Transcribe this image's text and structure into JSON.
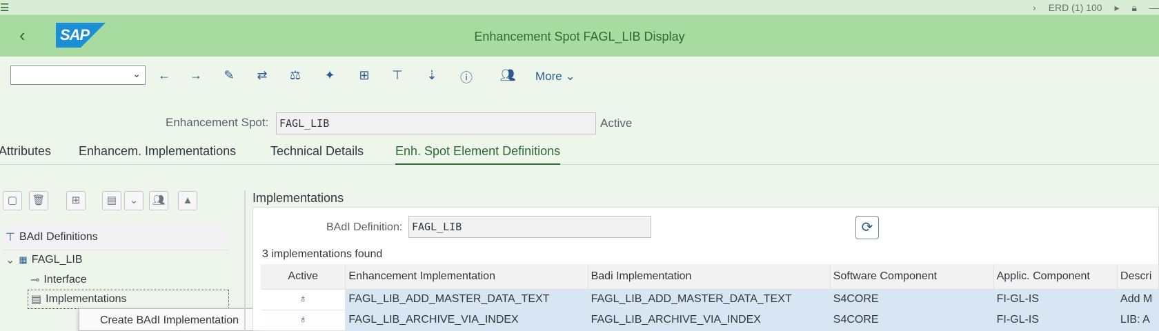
{
  "topbar": {
    "system": "ERD (1) 100"
  },
  "header": {
    "title": "Enhancement Spot FAGL_LIB Display",
    "logo": "SAP"
  },
  "toolbar": {
    "command_value": "",
    "more_label": "More"
  },
  "spot": {
    "label": "Enhancement Spot:",
    "value": "FAGL_LIB",
    "status": "Active"
  },
  "tabs": [
    {
      "label": "Attributes"
    },
    {
      "label": "Enhancem. Implementations"
    },
    {
      "label": "Technical Details"
    },
    {
      "label": "Enh. Spot Element Definitions"
    }
  ],
  "tree": {
    "header": "BAdI Definitions",
    "items": [
      {
        "label": "FAGL_LIB"
      },
      {
        "label": "Interface"
      },
      {
        "label": "Implementations"
      }
    ]
  },
  "context_menu": {
    "item": "Create BAdI Implementation"
  },
  "implementations": {
    "title": "Implementations",
    "badi_label": "BAdI Definition:",
    "badi_value": "FAGL_LIB",
    "found_text": "3  implementations found",
    "columns": [
      "Active",
      "Enhancement Implementation",
      "Badi Implementation",
      "Software Component",
      "Applic. Component",
      "Descri"
    ],
    "rows": [
      {
        "active": "♁",
        "enh": "FAGL_LIB_ADD_MASTER_DATA_TEXT",
        "badi": "FAGL_LIB_ADD_MASTER_DATA_TEXT",
        "sw": "S4CORE",
        "app": "FI-GL-IS",
        "desc": "Add M"
      },
      {
        "active": "♁",
        "enh": "FAGL_LIB_ARCHIVE_VIA_INDEX",
        "badi": "FAGL_LIB_ARCHIVE_VIA_INDEX",
        "sw": "S4CORE",
        "app": "FI-GL-IS",
        "desc": "LIB: A"
      }
    ]
  }
}
